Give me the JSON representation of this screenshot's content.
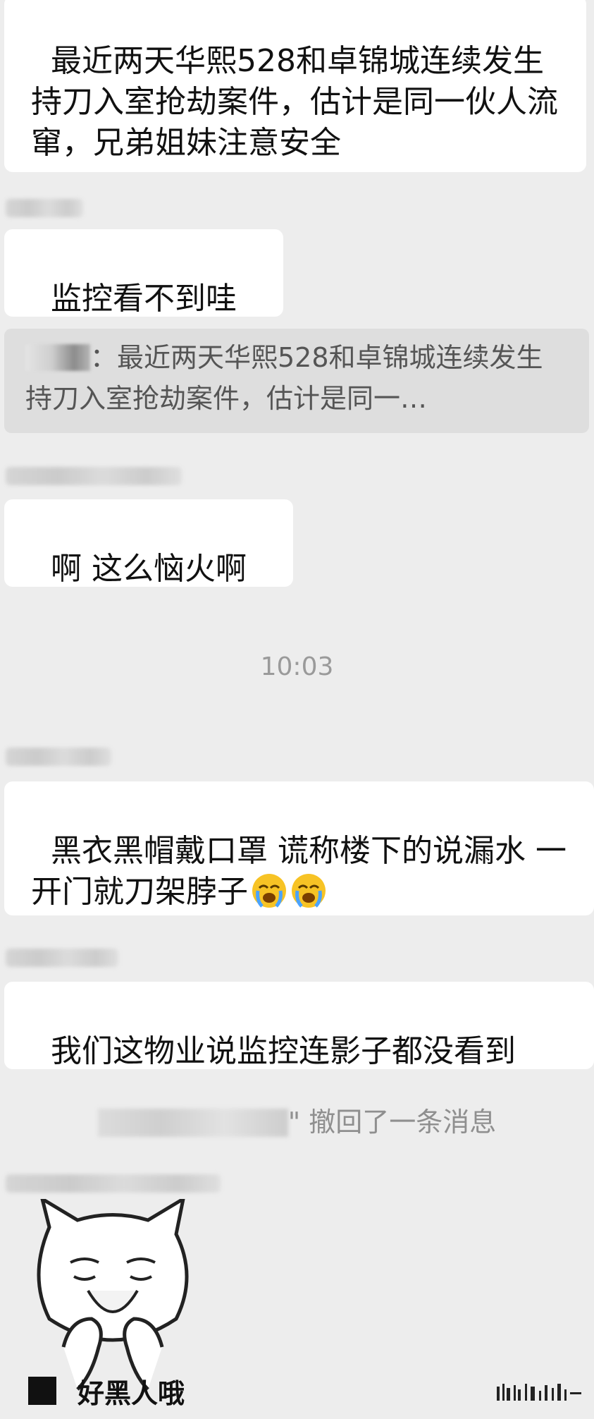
{
  "messages": {
    "m1": "最近两天华熙528和卓锦城连续发生持刀入室抢劫案件，估计是同一伙人流窜，兄弟姐妹注意安全",
    "m2": "监控看不到哇",
    "quote_text": "：最近两天华熙528和卓锦城连续发生持刀入室抢劫案件，估计是同一…",
    "m3": "啊 这么恼火啊",
    "timestamp": "10:03",
    "m4": "黑衣黑帽戴口罩 谎称楼下的说漏水 一开门就刀架脖子",
    "m5": "我们这物业说监控连影子都没看到",
    "recall_text": "\" 撤回了一条消息",
    "meme_caption": "好黑人哦"
  },
  "icons": {
    "crying_emoji": "loudly-crying-face-icon"
  },
  "colors": {
    "background": "#ededed",
    "bubble": "#ffffff",
    "quote_bg": "#dedede"
  }
}
